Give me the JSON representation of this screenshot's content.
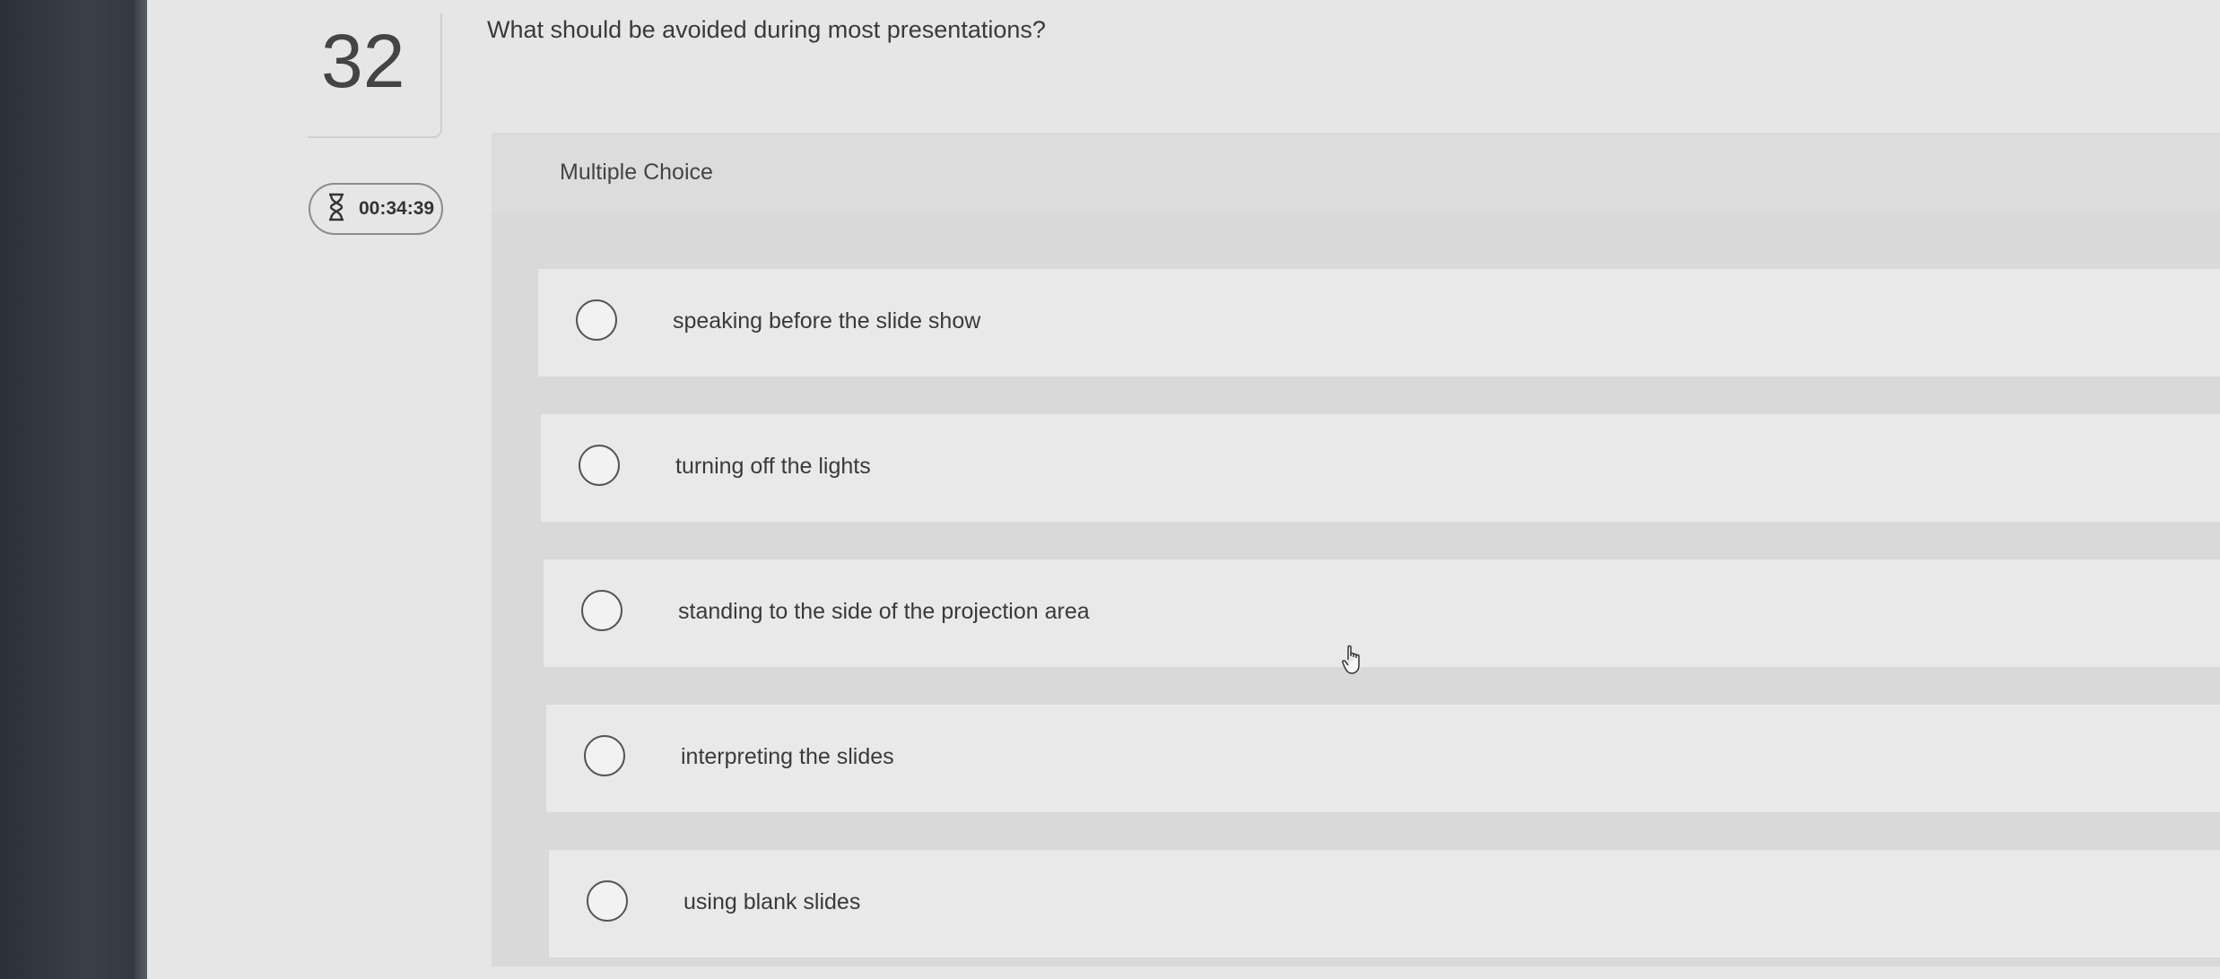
{
  "question": {
    "number": "32",
    "text": "What should be avoided during most presentations?",
    "type_label": "Multiple Choice"
  },
  "timer": {
    "value": "00:34:39",
    "icon": "hourglass-icon"
  },
  "options": [
    {
      "label": "speaking before the slide show",
      "selected": false
    },
    {
      "label": "turning off the lights",
      "selected": false
    },
    {
      "label": "standing to the side of the projection area",
      "selected": false
    },
    {
      "label": "interpreting the slides",
      "selected": false
    },
    {
      "label": "using blank slides",
      "selected": false
    }
  ]
}
